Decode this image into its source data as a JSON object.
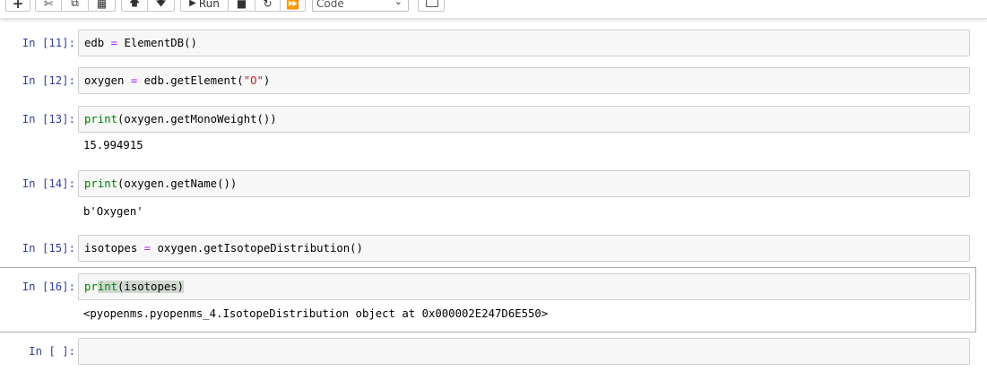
{
  "toolbar": {
    "buttons": [
      "+",
      "cut",
      "copy",
      "paste",
      "move-up",
      "move-down"
    ],
    "run_label": "Run",
    "cell_type": "Code",
    "cell_type_options": [
      "Code"
    ]
  },
  "cells": [
    {
      "prompt": "In [11]:",
      "code": {
        "var": "edb",
        "op": "=",
        "expr": "ElementDB()"
      }
    },
    {
      "prompt": "In [12]:",
      "code": {
        "var": "oxygen",
        "op": "=",
        "expr_pre": "edb.getElement(",
        "string": "\"O\"",
        "expr_post": ")"
      }
    },
    {
      "prompt": "In [13]:",
      "code": {
        "kw": "print",
        "rest": "(oxygen.getMonoWeight())"
      },
      "output": "15.994915"
    },
    {
      "prompt": "In [14]:",
      "code": {
        "kw": "print",
        "rest": "(oxygen.getName())"
      },
      "output": "b'Oxygen'"
    },
    {
      "prompt": "In [15]:",
      "code": {
        "var": "isotopes",
        "op": "=",
        "expr": "oxygen.getIsotopeDistribution()"
      }
    },
    {
      "prompt": "In [16]:",
      "code": {
        "kw_a": "pr",
        "kw_b": "int",
        "rest": "(isotopes)"
      },
      "output": "<pyopenms.pyopenms_4.IsotopeDistribution object at 0x000002E247D6E550>"
    },
    {
      "prompt": "In [ ]:",
      "code": {}
    }
  ]
}
